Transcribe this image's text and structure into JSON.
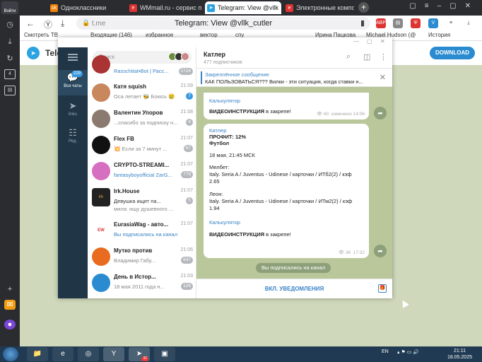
{
  "browser": {
    "logo_label": "Войти",
    "tabs": [
      {
        "label": "Одноклассники",
        "favicon": "ok-icon"
      },
      {
        "label": "WMmail.ru - сервис по",
        "favicon": "wm-icon"
      },
      {
        "label": "Telegram: View @vllk",
        "favicon": "telegram-icon",
        "active": true
      },
      {
        "label": "Электронные компоне",
        "favicon": "yandex-icon"
      }
    ],
    "address": {
      "domain": "t.me",
      "title": "Telegram: View @vllk_cutler"
    },
    "bookmarks": [
      {
        "label": "Смотреть ТВ"
      },
      {
        "label": "Входящие (146)"
      },
      {
        "label": "избранное"
      },
      {
        "label": "вектор"
      },
      {
        "label": "спу"
      },
      {
        "label": "Ирина Пацкова"
      },
      {
        "label": "Michael Hudson (@"
      },
      {
        "label": "История"
      }
    ],
    "ext_labels": {
      "abp": "ABP"
    }
  },
  "tgweb": {
    "name": "Tele",
    "download_label": "DOWNLOAD"
  },
  "tg": {
    "folders": [
      {
        "label": "Все чаты",
        "badge": "229"
      },
      {
        "label": "links"
      },
      {
        "label": "Ред."
      }
    ],
    "search_placeholder": "Поиск",
    "chats": [
      {
        "name": "",
        "time": "",
        "preview": "Rasschitat•Bot | Расс...",
        "badge": "2724",
        "badge_blue": false
      },
      {
        "name": "Катя squish",
        "time": "21:09",
        "preview": "Оса летает 🐝 Боюсь 😢",
        "badge": "7",
        "badge_blue": true
      },
      {
        "name": "Валентин Упоров",
        "time": "21:08",
        "preview": "...спасибо за подписку н...",
        "badge": "4",
        "badge_blue": false
      },
      {
        "name": "Flex FB",
        "time": "21:07",
        "preview": "💥 Если за 7 минут ...",
        "badge": "67",
        "badge_blue": false
      },
      {
        "name": "CRYPTO-STREAMI...",
        "time": "21:07",
        "preview": "fantasyboyofficial ZarG...",
        "badge": "779",
        "badge_blue": false
      },
      {
        "name": "Irk.House",
        "time": "21:07",
        "preview": "Девушка ищет па...",
        "preview2": "мила: ищу душевного ...",
        "badge": "5",
        "badge_blue": false
      },
      {
        "name": "EurasiaWag - авто...",
        "time": "21:07",
        "preview": "Вы подписались на канал",
        "badge": "",
        "badge_blue": false
      },
      {
        "name": "Мутко против",
        "time": "21:06",
        "preview": "Владимир Габу...",
        "badge": "647",
        "badge_blue": false
      },
      {
        "name": "День в Истор...",
        "time": "21:03",
        "preview": "18 мая 2011 года н...",
        "badge": "126",
        "badge_blue": false
      }
    ],
    "channel": {
      "name": "Катлер",
      "subs": "477 подписчиков"
    },
    "pinned": {
      "title": "Закреплённое сообщение",
      "text": "КАК ПОЛЬЗОВАТЬСЯ??? Вилки - эти ситуация, когда ставки н..."
    },
    "msg1": {
      "link": "Калькулятор",
      "text_bold": "ВИДЕОИНСТРУКЦИЯ",
      "text_rest": " в закрепе!",
      "views": "60",
      "meta": "изменено 14:06"
    },
    "msg2": {
      "sender": "Катлер",
      "profit": "ПРОФИТ: 12%",
      "sport": "Футбол",
      "date": "18 мая, 21:45 МСК",
      "b1": "Мелбет:",
      "b1_line": "Italy. Seria A / Juventus - Udinese / карточки / ИТб2(2) / кэф",
      "b1_odds": "2.65",
      "b2": "Леон:",
      "b2_line": "Italy. Seria A / Juventus - Udinese / карточки / ИТм2(2) / кэф",
      "b2_odds": "1.94",
      "link": "Калькулятор",
      "text_bold": "ВИДЕОИНСТРУКЦИЯ",
      "text_rest": " в закрепе!",
      "views": "36",
      "time": "17:32"
    },
    "service": "Вы подписались на канал",
    "notify_label": "ВКЛ. УВЕДОМЛЕНИЯ"
  },
  "taskbar": {
    "lang": "EN",
    "time": "21:11",
    "date": "18.05.2025",
    "tg_badge": "32"
  },
  "colors": {
    "accent": "#3a84c6",
    "rail": "#203545",
    "chat_bg": "#b9c79a"
  }
}
